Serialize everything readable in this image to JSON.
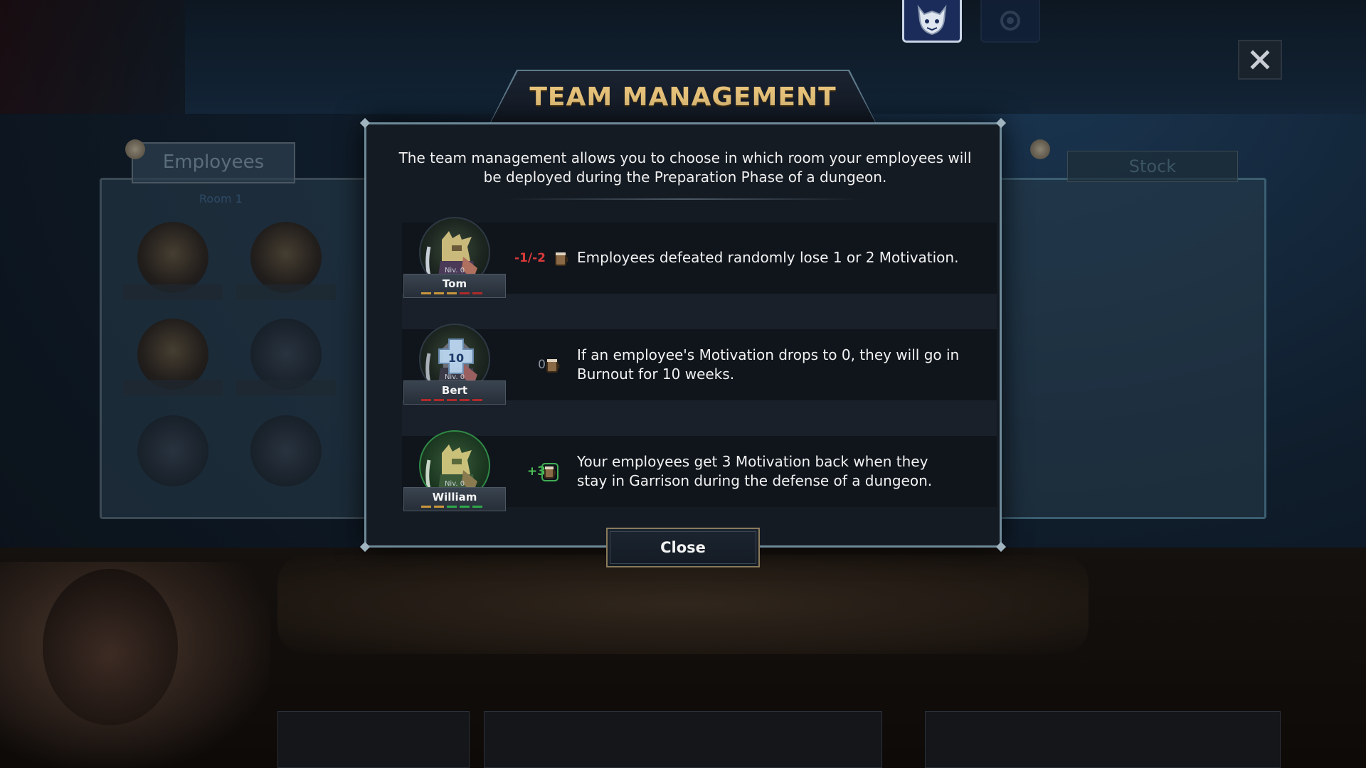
{
  "background": {
    "left_panel_tab": "Employees",
    "left_panel_room": "Room 1",
    "right_panel_tab": "Stock"
  },
  "modal": {
    "title": "TEAM MANAGEMENT",
    "intro": "The team management allows you to choose in which room your employees will be deployed during the Preparation Phase of a dungeon.",
    "rows": [
      {
        "name": "Tom",
        "level": "Niv. 0",
        "delta": "-1/-2",
        "delta_kind": "negative",
        "text": "Employees defeated randomly lose 1 or 2 Motivation.",
        "motivation_bars": [
          "#c8963c",
          "#c8963c",
          "#c8963c",
          "#b02a2a",
          "#b02a2a"
        ]
      },
      {
        "name": "Bert",
        "level": "Niv. 0",
        "delta": "0",
        "delta_kind": "zero",
        "portrait_badge": "10",
        "text": "If an employee's Motivation drops to 0, they will go in Burnout for 10 weeks.",
        "motivation_bars": [
          "#b02a2a",
          "#b02a2a",
          "#b02a2a",
          "#b02a2a",
          "#b02a2a"
        ]
      },
      {
        "name": "William",
        "level": "Niv. 0",
        "delta": "+3",
        "delta_kind": "positive",
        "text": "Your employees get 3 Motivation back when they stay in Garrison during the defense of a dungeon.",
        "motivation_bars": [
          "#c8963c",
          "#c8963c",
          "#2fa84a",
          "#2fa84a",
          "#2fa84a"
        ]
      }
    ],
    "close_label": "Close"
  },
  "icons": {
    "top_emblem": "demon-mask-icon",
    "top_emblem_2": "settings-emblem-icon",
    "window_close": "close-icon",
    "motivation": "motivation-mug-icon"
  }
}
